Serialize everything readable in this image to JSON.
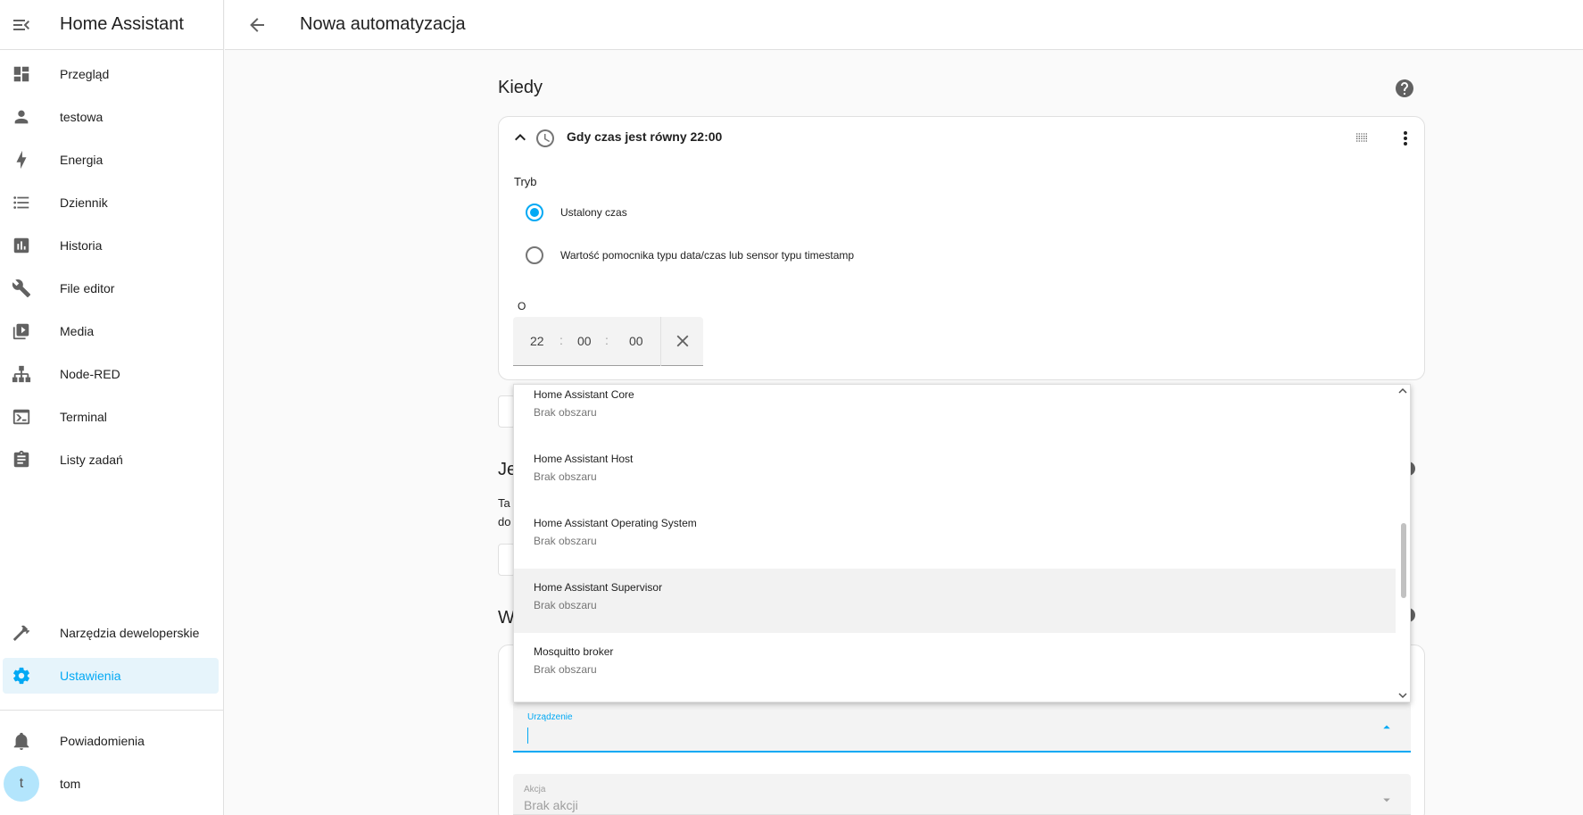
{
  "app": {
    "title": "Home Assistant"
  },
  "page": {
    "title": "Nowa automatyzacja"
  },
  "sidebar": {
    "items": [
      {
        "label": "Przegląd",
        "icon": "dashboard-icon"
      },
      {
        "label": "testowa",
        "icon": "person-icon"
      },
      {
        "label": "Energia",
        "icon": "lightning-icon"
      },
      {
        "label": "Dziennik",
        "icon": "list-icon"
      },
      {
        "label": "Historia",
        "icon": "chart-icon"
      },
      {
        "label": "File editor",
        "icon": "wrench-icon"
      },
      {
        "label": "Media",
        "icon": "media-icon"
      },
      {
        "label": "Node-RED",
        "icon": "sitemap-icon"
      },
      {
        "label": "Terminal",
        "icon": "terminal-icon"
      },
      {
        "label": "Listy zadań",
        "icon": "clipboard-icon"
      }
    ],
    "dev_tools": "Narzędzia deweloperskie",
    "settings": "Ustawienia",
    "notifications": "Powiadomienia",
    "user": {
      "initial": "t",
      "name": "tom"
    }
  },
  "when": {
    "heading": "Kiedy",
    "trigger_title": "Gdy czas jest równy 22:00",
    "mode_label": "Tryb",
    "options": [
      "Ustalony czas",
      "Wartość pomocnika typu data/czas lub sensor typu timestamp"
    ],
    "selected_option": 0,
    "at_label": "O",
    "time": {
      "hours": "22",
      "minutes": "00",
      "seconds": "00",
      "separator": ":"
    }
  },
  "partial": {
    "if_heading_fragment": "Je",
    "line1_fragment": "Ta",
    "line2_fragment": "do",
    "then_heading_fragment": "W"
  },
  "dropdown": {
    "items": [
      {
        "name": "Home Assistant Core",
        "area": "Brak obszaru"
      },
      {
        "name": "Home Assistant Host",
        "area": "Brak obszaru"
      },
      {
        "name": "Home Assistant Operating System",
        "area": "Brak obszaru"
      },
      {
        "name": "Home Assistant Supervisor",
        "area": "Brak obszaru"
      },
      {
        "name": "Mosquitto broker",
        "area": "Brak obszaru"
      }
    ],
    "highlighted_index": 3
  },
  "device_field": {
    "label": "Urządzenie",
    "value": ""
  },
  "action_field": {
    "label": "Akcja",
    "value": "Brak akcji"
  },
  "colors": {
    "accent": "#03a9f4",
    "text": "#212121",
    "secondary": "#757575"
  }
}
